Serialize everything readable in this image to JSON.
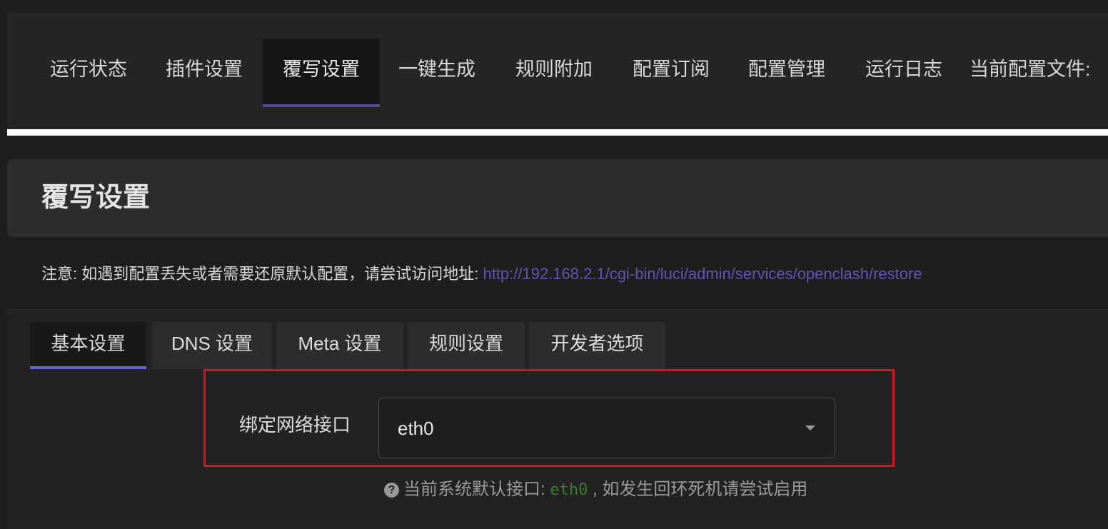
{
  "top_nav": {
    "tabs": [
      {
        "label": "运行状态"
      },
      {
        "label": "插件设置"
      },
      {
        "label": "覆写设置",
        "active": true
      },
      {
        "label": "一键生成"
      },
      {
        "label": "规则附加"
      },
      {
        "label": "配置订阅"
      },
      {
        "label": "配置管理"
      },
      {
        "label": "运行日志"
      },
      {
        "label": "当前配置文件:"
      }
    ]
  },
  "page_title": "覆写设置",
  "notice": {
    "text": "注意: 如遇到配置丢失或者需要还原默认配置，请尝试访问地址: ",
    "link": "http://192.168.2.1/cgi-bin/luci/admin/services/openclash/restore"
  },
  "sub_tabs": [
    {
      "label": "基本设置",
      "active": true
    },
    {
      "label": "DNS 设置"
    },
    {
      "label": "Meta 设置"
    },
    {
      "label": "规则设置"
    },
    {
      "label": "开发者选项"
    }
  ],
  "bind_interface": {
    "label": "绑定网络接口",
    "value": "eth0",
    "hint_icon": "question-circle-icon",
    "hint_prefix": "当前系统默认接口:",
    "hint_iface": "eth0",
    "hint_suffix": ", 如发生回环死机请尝试启用"
  },
  "colors": {
    "accent": "#5b4a9c",
    "link": "#5f55b3",
    "highlight": "#d8141c",
    "iface_green": "#3e7b33"
  }
}
